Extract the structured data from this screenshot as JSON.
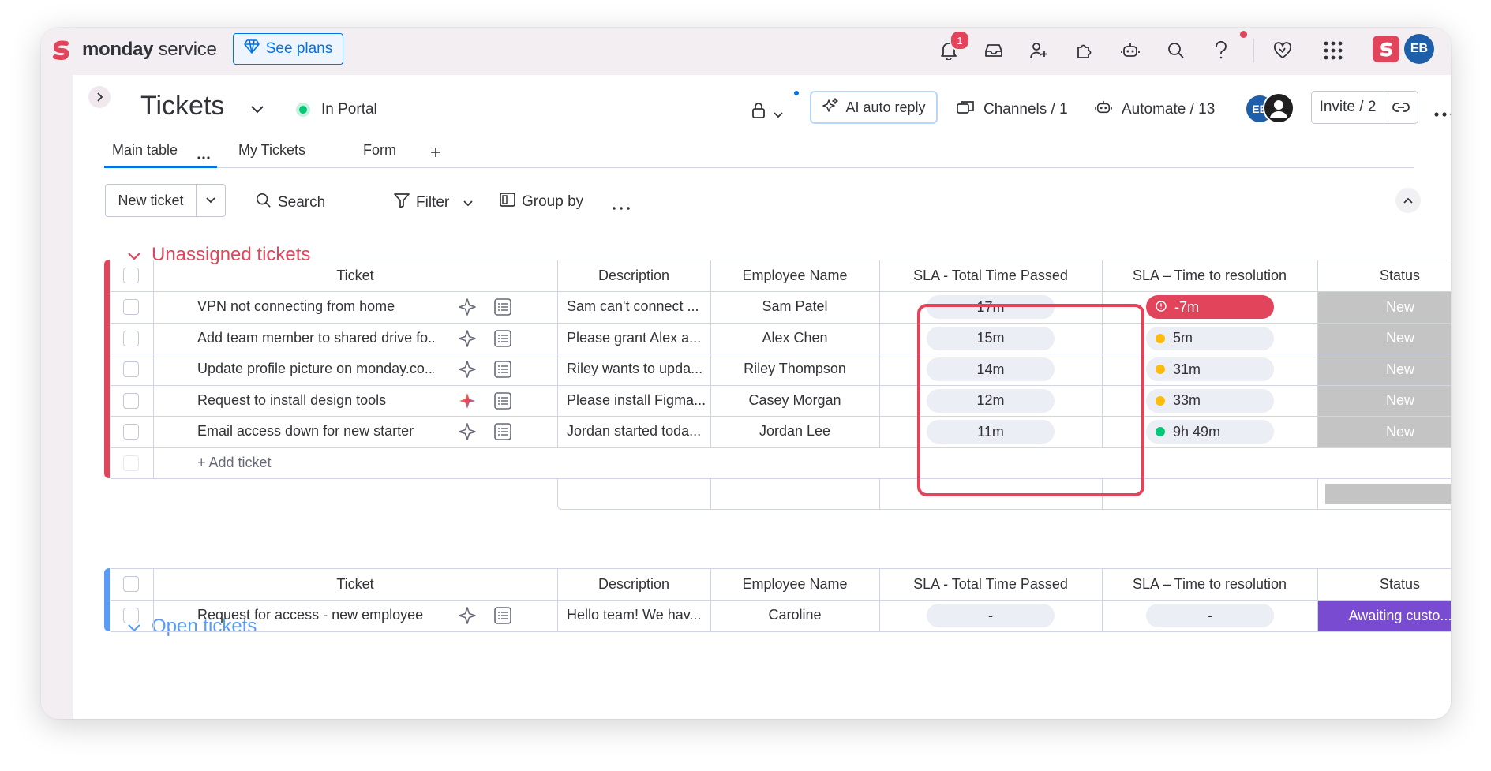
{
  "topbar": {
    "brand_bold": "monday",
    "brand_light": " service",
    "see_plans": "See plans",
    "notifications_count": "1",
    "avatar_initials": "EB",
    "icons": [
      "bell-icon",
      "inbox-icon",
      "add-user-icon",
      "puzzle-icon",
      "robot-icon",
      "search-icon",
      "help-icon",
      "heart-icon",
      "apps-grid-icon"
    ]
  },
  "header": {
    "title": "Tickets",
    "portal_status": "In Portal",
    "ai_auto_reply": "AI auto reply",
    "channels": "Channels / 1",
    "automate": "Automate / 13",
    "avatar_initials": "EB",
    "invite": "Invite / 2"
  },
  "tabs": [
    {
      "label": "Main table",
      "active": true
    },
    {
      "label": "My Tickets"
    },
    {
      "label": "Form"
    }
  ],
  "toolbar": {
    "new_ticket": "New ticket",
    "search": "Search",
    "filter": "Filter",
    "group_by": "Group by"
  },
  "columns": [
    "Ticket",
    "Description",
    "Employee Name",
    "SLA - Total Time Passed",
    "SLA – Time to resolution",
    "Status"
  ],
  "groups": [
    {
      "title": "Unassigned tickets",
      "color": "#e2445c",
      "add_label": "+ Add ticket",
      "rows": [
        {
          "ticket": "VPN not connecting from home",
          "description": "Sam can't connect ...",
          "employee": "Sam Patel",
          "total_time": "17m",
          "resolution": "-7m",
          "resolution_state": "overdue",
          "status": "New"
        },
        {
          "ticket": "Add team member to shared drive fo...",
          "description": "Please grant Alex a...",
          "employee": "Alex Chen",
          "total_time": "15m",
          "resolution": "5m",
          "resolution_state": "warning",
          "status": "New"
        },
        {
          "ticket": "Update profile picture on monday.co...",
          "description": "Riley wants to upda...",
          "employee": "Riley Thompson",
          "total_time": "14m",
          "resolution": "31m",
          "resolution_state": "warning",
          "status": "New"
        },
        {
          "ticket": "Request to install design tools",
          "description": "Please install Figma...",
          "employee": "Casey Morgan",
          "total_time": "12m",
          "resolution": "33m",
          "resolution_state": "warning",
          "status": "New",
          "ai_active": true
        },
        {
          "ticket": "Email access down for new starter",
          "description": "Jordan started toda...",
          "employee": "Jordan Lee",
          "total_time": "11m",
          "resolution": "9h 49m",
          "resolution_state": "ok",
          "status": "New"
        }
      ]
    },
    {
      "title": "Open tickets",
      "color": "#579bfc",
      "rows": [
        {
          "ticket": "Request for access - new employee",
          "description": "Hello team! We hav...",
          "employee": "Caroline",
          "total_time": "-",
          "resolution": "-",
          "resolution_state": "none",
          "status": "Awaiting custo..."
        }
      ]
    }
  ],
  "colors": {
    "status_new": "#c4c4c4",
    "status_awaiting": "#784bd1",
    "overdue": "#e2445c",
    "warning": "#fdbc0b",
    "ok": "#00c875",
    "accent": "#0073ea",
    "highlight": "#e2445c"
  }
}
